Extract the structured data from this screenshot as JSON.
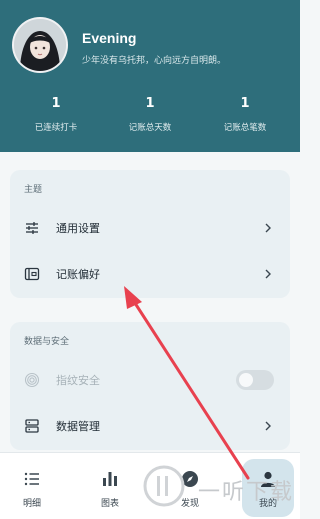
{
  "profile": {
    "name": "Evening",
    "motto": "少年没有乌托邦，心向远方自明朗。"
  },
  "stats": [
    {
      "value": "1",
      "label": "已连续打卡"
    },
    {
      "value": "1",
      "label": "记账总天数"
    },
    {
      "value": "1",
      "label": "记账总笔数"
    }
  ],
  "theme_section": {
    "title": "主题",
    "items": [
      {
        "label": "通用设置",
        "icon": "sliders-icon"
      },
      {
        "label": "记账偏好",
        "icon": "wallet-icon"
      }
    ]
  },
  "data_section": {
    "title": "数据与安全",
    "items": [
      {
        "label": "指纹安全",
        "icon": "fingerprint-icon",
        "toggle": false
      },
      {
        "label": "数据管理",
        "icon": "database-icon"
      }
    ]
  },
  "nav": [
    {
      "label": "明细",
      "icon": "list-icon"
    },
    {
      "label": "图表",
      "icon": "bar-chart-icon"
    },
    {
      "label": "发现",
      "icon": "compass-icon"
    },
    {
      "label": "我的",
      "icon": "person-icon",
      "active": true
    }
  ],
  "watermark": {
    "text": "一听下载"
  },
  "colors": {
    "header": "#2e6e7b",
    "card": "#e9f0f3",
    "annotation_arrow": "#e8414f",
    "active_tab": "#d3e4ec"
  }
}
